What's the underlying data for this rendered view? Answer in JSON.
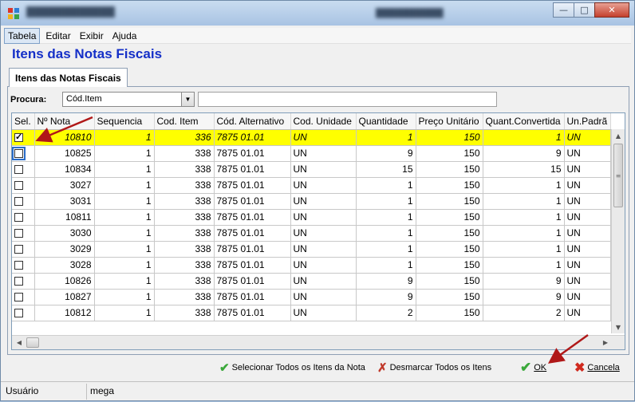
{
  "menu": [
    "Tabela",
    "Editar",
    "Exibir",
    "Ajuda"
  ],
  "page_title": "Itens das Notas Fiscais",
  "tab_label": "Itens das Notas Fiscais",
  "search": {
    "label": "Procura:",
    "field_value": "Cód.Item",
    "query": ""
  },
  "table": {
    "columns": [
      "Sel.",
      "Nº Nota",
      "Sequencia",
      "Cod. Item",
      "Cód. Alternativo",
      "Cod. Unidade",
      "Quantidade",
      "Preço Unitário",
      "Quant.Convertida",
      "Un.Padrã"
    ],
    "rows": [
      {
        "sel": true,
        "nota": "10810",
        "seq": "1",
        "item": "336",
        "alt": "7875 01.01",
        "un": "UN",
        "qtd": "1",
        "preco": "150",
        "conv": "1",
        "padrao": "UN",
        "highlight": true
      },
      {
        "sel": false,
        "nota": "10825",
        "seq": "1",
        "item": "338",
        "alt": "7875 01.01",
        "un": "UN",
        "qtd": "9",
        "preco": "150",
        "conv": "9",
        "padrao": "UN",
        "focus": true
      },
      {
        "sel": false,
        "nota": "10834",
        "seq": "1",
        "item": "338",
        "alt": "7875 01.01",
        "un": "UN",
        "qtd": "15",
        "preco": "150",
        "conv": "15",
        "padrao": "UN"
      },
      {
        "sel": false,
        "nota": "3027",
        "seq": "1",
        "item": "338",
        "alt": "7875 01.01",
        "un": "UN",
        "qtd": "1",
        "preco": "150",
        "conv": "1",
        "padrao": "UN"
      },
      {
        "sel": false,
        "nota": "3031",
        "seq": "1",
        "item": "338",
        "alt": "7875 01.01",
        "un": "UN",
        "qtd": "1",
        "preco": "150",
        "conv": "1",
        "padrao": "UN"
      },
      {
        "sel": false,
        "nota": "10811",
        "seq": "1",
        "item": "338",
        "alt": "7875 01.01",
        "un": "UN",
        "qtd": "1",
        "preco": "150",
        "conv": "1",
        "padrao": "UN"
      },
      {
        "sel": false,
        "nota": "3030",
        "seq": "1",
        "item": "338",
        "alt": "7875 01.01",
        "un": "UN",
        "qtd": "1",
        "preco": "150",
        "conv": "1",
        "padrao": "UN"
      },
      {
        "sel": false,
        "nota": "3029",
        "seq": "1",
        "item": "338",
        "alt": "7875 01.01",
        "un": "UN",
        "qtd": "1",
        "preco": "150",
        "conv": "1",
        "padrao": "UN"
      },
      {
        "sel": false,
        "nota": "3028",
        "seq": "1",
        "item": "338",
        "alt": "7875 01.01",
        "un": "UN",
        "qtd": "1",
        "preco": "150",
        "conv": "1",
        "padrao": "UN"
      },
      {
        "sel": false,
        "nota": "10826",
        "seq": "1",
        "item": "338",
        "alt": "7875 01.01",
        "un": "UN",
        "qtd": "9",
        "preco": "150",
        "conv": "9",
        "padrao": "UN"
      },
      {
        "sel": false,
        "nota": "10827",
        "seq": "1",
        "item": "338",
        "alt": "7875 01.01",
        "un": "UN",
        "qtd": "9",
        "preco": "150",
        "conv": "9",
        "padrao": "UN"
      },
      {
        "sel": false,
        "nota": "10812",
        "seq": "1",
        "item": "338",
        "alt": "7875 01.01",
        "un": "UN",
        "qtd": "2",
        "preco": "150",
        "conv": "2",
        "padrao": "UN"
      }
    ]
  },
  "actions": {
    "select_all": "Selecionar Todos os Itens da Nota",
    "deselect_all": "Desmarcar Todos os Itens",
    "ok": "OK",
    "cancel": "Cancela"
  },
  "status": {
    "label": "Usuário",
    "value": "mega"
  },
  "colors": {
    "title_blue": "#1530c8",
    "row_highlight": "#ffff00",
    "arrow_red": "#b01818"
  },
  "icons": [
    "app-icon",
    "minimize-icon",
    "maximize-icon",
    "close-icon",
    "dropdown-arrow-icon",
    "checkmark-icon",
    "uncheck-icon",
    "cancel-x-icon"
  ]
}
